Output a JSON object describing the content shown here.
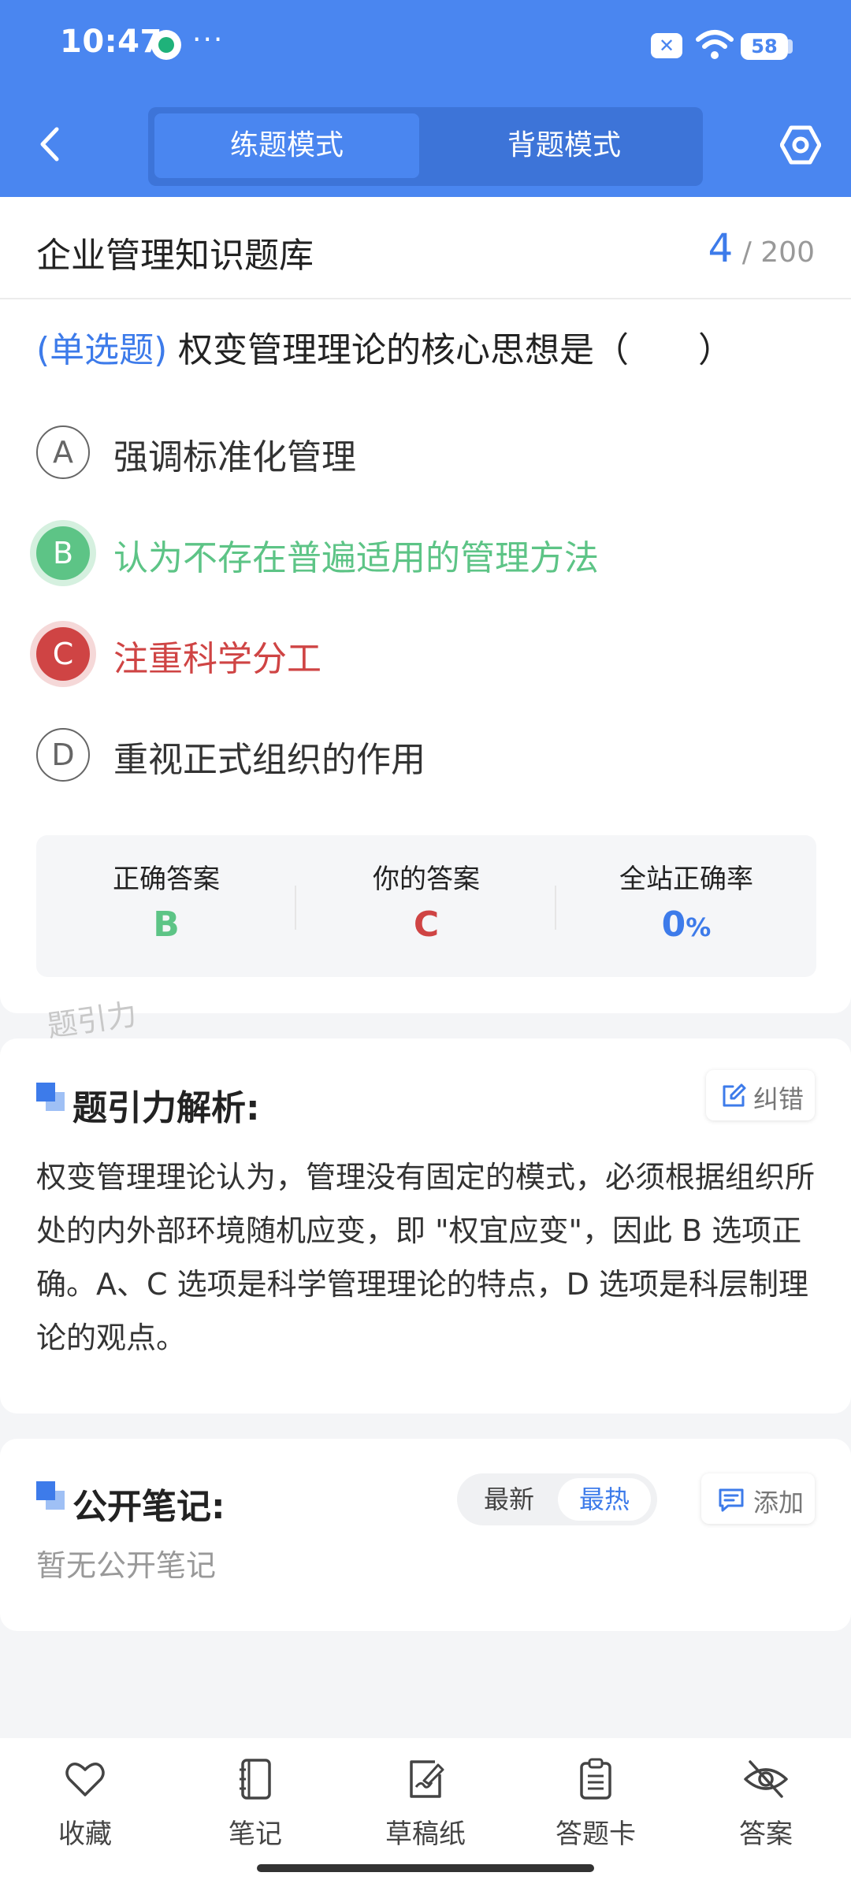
{
  "status_bar": {
    "time": "10:47",
    "more": "···",
    "battery": "58"
  },
  "header": {
    "tabs": [
      {
        "label": "练题模式",
        "active": true
      },
      {
        "label": "背题模式",
        "active": false
      }
    ],
    "accent_color": "#4a86f0"
  },
  "question": {
    "bank_title": "企业管理知识题库",
    "progress_current": "4",
    "progress_total": "/ 200",
    "type": "(单选题)",
    "text": "权变管理理论的核心思想是（　　）",
    "options": [
      {
        "letter": "A",
        "text": "强调标准化管理",
        "state": "default"
      },
      {
        "letter": "B",
        "text": "认为不存在普遍适用的管理方法",
        "state": "correct"
      },
      {
        "letter": "C",
        "text": "注重科学分工",
        "state": "wrong"
      },
      {
        "letter": "D",
        "text": "重视正式组织的作用",
        "state": "default"
      }
    ],
    "stats": {
      "correct_label": "正确答案",
      "correct_value": "B",
      "yours_label": "你的答案",
      "yours_value": "C",
      "rate_label": "全站正确率",
      "rate_value": "0",
      "rate_unit": "%"
    },
    "colors": {
      "correct": "#5dc486",
      "wrong": "#cf4444",
      "accent": "#3d7bea"
    }
  },
  "watermark": "题引力",
  "analysis": {
    "title": "题引力解析:",
    "correct_button": "纠错",
    "text": "权变管理理论认为，管理没有固定的模式，必须根据组织所处的内外部环境随机应变，即 \"权宜应变\"，因此 B 选项正确。A、C 选项是科学管理理论的特点，D 选项是科层制理论的观点。"
  },
  "notes": {
    "title": "公开笔记:",
    "sort_options": [
      "最新",
      "最热"
    ],
    "sort_active": "最热",
    "add_button": "添加",
    "empty_text": "暂无公开笔记"
  },
  "bottom_nav": [
    {
      "label": "收藏",
      "icon": "heart-icon"
    },
    {
      "label": "笔记",
      "icon": "notebook-icon"
    },
    {
      "label": "草稿纸",
      "icon": "draft-paper-icon"
    },
    {
      "label": "答题卡",
      "icon": "clipboard-icon"
    },
    {
      "label": "答案",
      "icon": "eye-off-icon"
    }
  ]
}
